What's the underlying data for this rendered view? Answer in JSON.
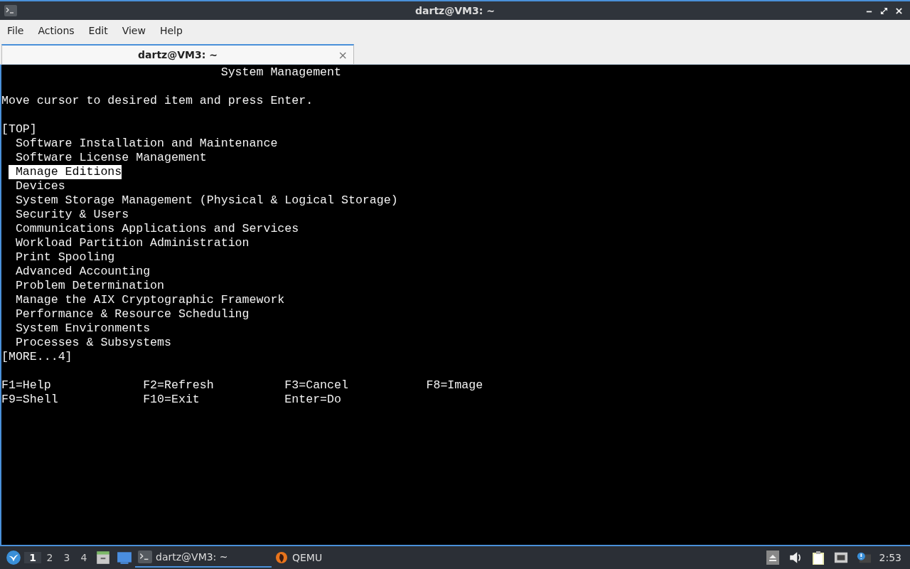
{
  "window": {
    "title": "dartz@VM3: ~"
  },
  "menu": [
    "File",
    "Actions",
    "Edit",
    "View",
    "Help"
  ],
  "tabs": [
    {
      "label": "dartz@VM3: ~",
      "selected": true,
      "close": "×"
    }
  ],
  "terminal": {
    "title": "System Management",
    "prompt": "Move cursor to desired item and press Enter.",
    "top_marker": "[TOP]",
    "items": [
      {
        "label": "Software Installation and Maintenance",
        "selected": false
      },
      {
        "label": "Software License Management",
        "selected": false
      },
      {
        "label": "Manage Editions",
        "selected": true
      },
      {
        "label": "Devices",
        "selected": false
      },
      {
        "label": "System Storage Management (Physical & Logical Storage)",
        "selected": false
      },
      {
        "label": "Security & Users",
        "selected": false
      },
      {
        "label": "Communications Applications and Services",
        "selected": false
      },
      {
        "label": "Workload Partition Administration",
        "selected": false
      },
      {
        "label": "Print Spooling",
        "selected": false
      },
      {
        "label": "Advanced Accounting",
        "selected": false
      },
      {
        "label": "Problem Determination",
        "selected": false
      },
      {
        "label": "Manage the AIX Cryptographic Framework",
        "selected": false
      },
      {
        "label": "Performance & Resource Scheduling",
        "selected": false
      },
      {
        "label": "System Environments",
        "selected": false
      },
      {
        "label": "Processes & Subsystems",
        "selected": false
      }
    ],
    "more_marker": "[MORE...4]",
    "function_keys": [
      "F1=Help",
      "F2=Refresh",
      "F3=Cancel",
      "F8=Image",
      "F9=Shell",
      "F10=Exit",
      "Enter=Do"
    ]
  },
  "taskbar": {
    "workspaces": [
      {
        "label": "1",
        "selected": true
      },
      {
        "label": "2",
        "selected": false
      },
      {
        "label": "3",
        "selected": false
      },
      {
        "label": "4",
        "selected": false
      }
    ],
    "tasks": [
      {
        "label": "dartz@VM3: ~",
        "selected": true,
        "kind": "terminal"
      },
      {
        "label": "QEMU",
        "selected": false,
        "kind": "qemu"
      }
    ],
    "clock": "2:53"
  }
}
